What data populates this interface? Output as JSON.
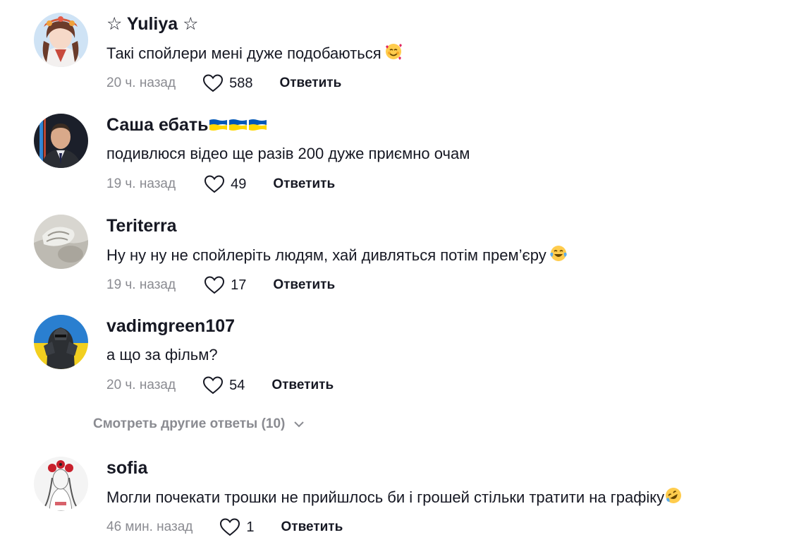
{
  "comments": [
    {
      "username": "☆ Yuliya ☆",
      "text": "Такі спойлери мені дуже подобаються",
      "time": "20 ч. назад",
      "likes": "588",
      "reply_label": "Ответить",
      "emoji": "smiling-face-with-hearts"
    },
    {
      "username": "Саша ебать",
      "text": "подивлюся відео ще разів 200 дуже приємно очам",
      "time": "19 ч. назад",
      "likes": "49",
      "reply_label": "Ответить",
      "flags": [
        "ukraine-flag",
        "ukraine-flag",
        "ukraine-flag"
      ]
    },
    {
      "username": "Teriterra",
      "text": "Ну ну ну не спойлеріть людям, хай дивляться потім прем’єру",
      "time": "19 ч. назад",
      "likes": "17",
      "reply_label": "Ответить",
      "emoji": "face-with-tears-of-joy"
    },
    {
      "username": "vadimgreen107",
      "text": "а що за фільм?",
      "time": "20 ч. назад",
      "likes": "54",
      "reply_label": "Ответить"
    },
    {
      "username": "sofia",
      "text": "Могли почекати трошки не прийшлось би і грошей стільки тратити на графіку",
      "time": "46 мин. назад",
      "likes": "1",
      "reply_label": "Ответить",
      "emoji": "rolling-on-floor-laughing"
    }
  ],
  "view_more_replies": "Смотреть другие ответы (10)",
  "colors": {
    "text": "#161823",
    "secondary": "#8a8b91",
    "ukraine_blue": "#0057b7",
    "ukraine_yellow": "#ffd700"
  }
}
